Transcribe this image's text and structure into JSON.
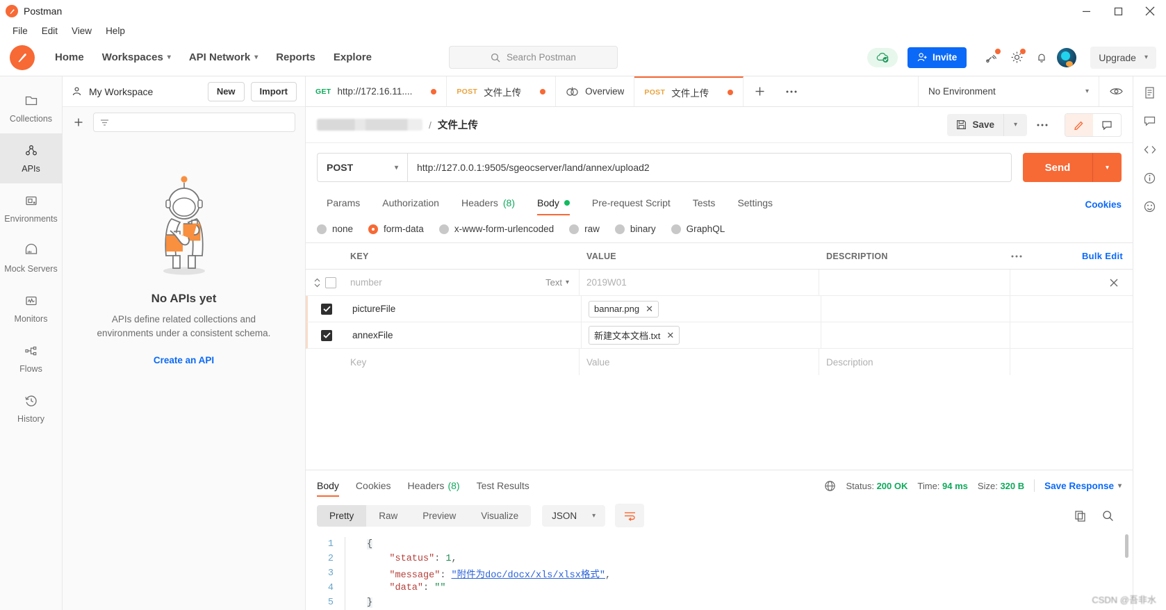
{
  "window": {
    "app_title": "Postman",
    "controls": [
      "minimize",
      "maximize",
      "close"
    ]
  },
  "menubar": {
    "items": [
      "File",
      "Edit",
      "View",
      "Help"
    ]
  },
  "header": {
    "nav": [
      {
        "label": "Home",
        "caret": false
      },
      {
        "label": "Workspaces",
        "caret": true
      },
      {
        "label": "API Network",
        "caret": true
      },
      {
        "label": "Reports",
        "caret": false
      },
      {
        "label": "Explore",
        "caret": false
      }
    ],
    "search_placeholder": "Search Postman",
    "invite_label": "Invite",
    "upgrade_label": "Upgrade",
    "icons": [
      "cloud-sync-icon",
      "invite-icon",
      "satellite-icon",
      "gear-icon",
      "bell-icon",
      "avatar-icon",
      "chevron-down-icon"
    ]
  },
  "sidebar": {
    "items": [
      {
        "label": "Collections",
        "icon": "collections-icon",
        "active": false
      },
      {
        "label": "APIs",
        "icon": "apis-icon",
        "active": true
      },
      {
        "label": "Environments",
        "icon": "environments-icon",
        "active": false
      },
      {
        "label": "Mock Servers",
        "icon": "mock-servers-icon",
        "active": false
      },
      {
        "label": "Monitors",
        "icon": "monitors-icon",
        "active": false
      },
      {
        "label": "Flows",
        "icon": "flows-icon",
        "active": false
      },
      {
        "label": "History",
        "icon": "history-icon",
        "active": false
      }
    ]
  },
  "workspace": {
    "name": "My Workspace",
    "new_label": "New",
    "import_label": "Import",
    "filter_placeholder": "",
    "empty": {
      "title": "No APIs yet",
      "subtitle": "APIs define related collections and environments under a consistent schema.",
      "link": "Create an API"
    }
  },
  "tabs": {
    "items": [
      {
        "method": "GET",
        "title": "http://172.16.11....",
        "unsaved": true,
        "active": false
      },
      {
        "method": "POST",
        "title": "文件上传",
        "unsaved": true,
        "active": false
      },
      {
        "method": "",
        "title": "Overview",
        "unsaved": false,
        "active": false,
        "icon": "overview-icon"
      },
      {
        "method": "POST",
        "title": "文件上传",
        "unsaved": true,
        "active": true
      }
    ],
    "environment": "No Environment"
  },
  "request": {
    "breadcrumb_name": "文件上传",
    "save_label": "Save",
    "method": "POST",
    "url": "http://127.0.0.1:9505/sgeocserver/land/annex/upload2",
    "send_label": "Send",
    "tabs": [
      {
        "label": "Params",
        "active": false
      },
      {
        "label": "Authorization",
        "active": false
      },
      {
        "label": "Headers",
        "count": "(8)",
        "active": false
      },
      {
        "label": "Body",
        "dot": true,
        "active": true
      },
      {
        "label": "Pre-request Script",
        "active": false
      },
      {
        "label": "Tests",
        "active": false
      },
      {
        "label": "Settings",
        "active": false
      }
    ],
    "cookies_link": "Cookies",
    "body_modes": [
      {
        "label": "none",
        "selected": false
      },
      {
        "label": "form-data",
        "selected": true
      },
      {
        "label": "x-www-form-urlencoded",
        "selected": false
      },
      {
        "label": "raw",
        "selected": false
      },
      {
        "label": "binary",
        "selected": false
      },
      {
        "label": "GraphQL",
        "selected": false
      }
    ],
    "table": {
      "headers": [
        "KEY",
        "VALUE",
        "DESCRIPTION"
      ],
      "bulk_edit": "Bulk Edit",
      "rows": [
        {
          "checked": false,
          "key": "number",
          "key_placeholder": true,
          "type": "Text",
          "value": "2019W01",
          "value_placeholder": true,
          "description": "",
          "has_delete": true
        },
        {
          "checked": true,
          "key": "pictureFile",
          "key_placeholder": false,
          "value": "bannar.png",
          "is_file": true,
          "description": ""
        },
        {
          "checked": true,
          "key": "annexFile",
          "key_placeholder": false,
          "value": "新建文本文档.txt",
          "is_file": true,
          "description": ""
        },
        {
          "checked": false,
          "key": "Key",
          "key_placeholder": true,
          "value": "Value",
          "value_placeholder": true,
          "description": "Description",
          "desc_placeholder": true
        }
      ]
    }
  },
  "response": {
    "tabs": [
      {
        "label": "Body",
        "active": true
      },
      {
        "label": "Cookies",
        "active": false
      },
      {
        "label": "Headers",
        "count": "(8)",
        "active": false
      },
      {
        "label": "Test Results",
        "active": false
      }
    ],
    "status_label": "Status:",
    "status_value": "200 OK",
    "time_label": "Time:",
    "time_value": "94 ms",
    "size_label": "Size:",
    "size_value": "320 B",
    "save_response": "Save Response",
    "format_tabs": [
      {
        "label": "Pretty",
        "active": true
      },
      {
        "label": "Raw",
        "active": false
      },
      {
        "label": "Preview",
        "active": false
      },
      {
        "label": "Visualize",
        "active": false
      }
    ],
    "language": "JSON",
    "code_lines": [
      {
        "n": "1",
        "text": "{"
      },
      {
        "n": "2",
        "key": "\"status\"",
        "sep": ": ",
        "val": "1",
        "val_type": "num",
        "tail": ","
      },
      {
        "n": "3",
        "key": "\"message\"",
        "sep": ": ",
        "val": "\"附件为doc/docx/xls/xlsx格式\"",
        "val_type": "str-link",
        "tail": ","
      },
      {
        "n": "4",
        "key": "\"data\"",
        "sep": ": ",
        "val": "\"\"",
        "val_type": "str",
        "tail": ""
      },
      {
        "n": "5",
        "text": "}"
      }
    ]
  },
  "right_rail": {
    "icons": [
      "documentation-icon",
      "comments-icon",
      "code-icon",
      "info-icon",
      "feedback-icon"
    ]
  },
  "watermark": "CSDN @吾非水",
  "colors": {
    "accent": "#f76935",
    "blue": "#0b69f7",
    "green": "#0fa95c",
    "post": "#e8a33d",
    "get": "#0fa95c"
  }
}
